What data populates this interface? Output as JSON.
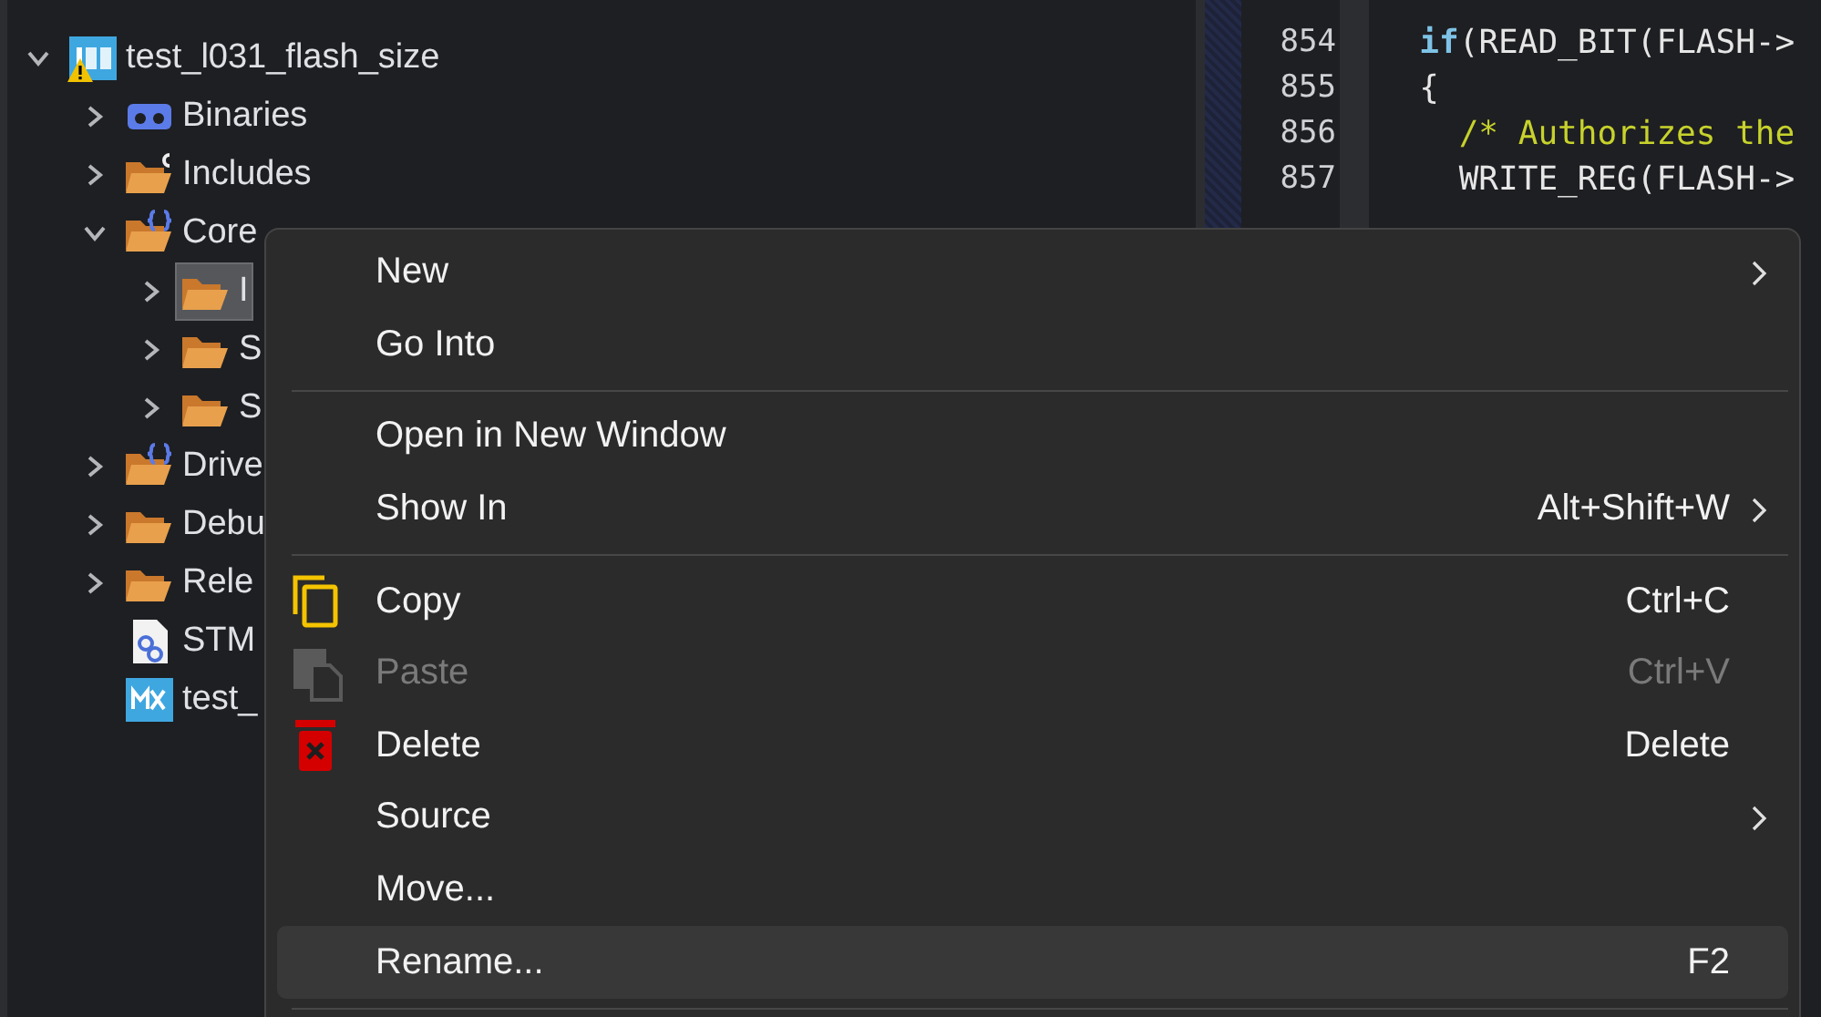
{
  "project_tree": [
    {
      "label": "test_l031_flash_size",
      "kind": "project",
      "expanded": true,
      "selected": false,
      "warning": true,
      "children": [
        {
          "label": "Binaries",
          "kind": "binaries",
          "expanded": false,
          "selected": false
        },
        {
          "label": "Includes",
          "kind": "includes",
          "expanded": false,
          "selected": false
        },
        {
          "label": "Core",
          "kind": "source-folder",
          "expanded": true,
          "selected": false,
          "children": [
            {
              "label": "I",
              "kind": "folder",
              "expanded": false,
              "selected": true
            },
            {
              "label": "S",
              "kind": "folder",
              "expanded": false,
              "selected": false
            },
            {
              "label": "S",
              "kind": "folder",
              "expanded": false,
              "selected": false
            }
          ]
        },
        {
          "label": "Drive",
          "kind": "source-folder",
          "expanded": false,
          "selected": false
        },
        {
          "label": "Debu",
          "kind": "folder",
          "expanded": false,
          "selected": false
        },
        {
          "label": "Rele",
          "kind": "folder",
          "expanded": false,
          "selected": false
        },
        {
          "label": "STM",
          "kind": "config-file",
          "selected": false
        },
        {
          "label": "test_",
          "kind": "mx-file",
          "selected": false
        }
      ]
    }
  ],
  "editor": {
    "lines": [
      {
        "number": "854",
        "segments": [
          {
            "kind": "keyword",
            "text": "  if"
          },
          {
            "kind": "plain",
            "text": "(READ_BIT(FLASH->"
          }
        ]
      },
      {
        "number": "855",
        "segments": [
          {
            "kind": "plain",
            "text": "  {"
          }
        ]
      },
      {
        "number": "856",
        "segments": [
          {
            "kind": "comment",
            "text": "    /* Authorizes the"
          }
        ]
      },
      {
        "number": "857",
        "segments": [
          {
            "kind": "plain",
            "text": "    WRITE_REG(FLASH->"
          }
        ]
      }
    ]
  },
  "context_menu": {
    "items": [
      {
        "kind": "plain",
        "label": "New",
        "submenu": true,
        "disabled": false,
        "highlighted": false
      },
      {
        "kind": "plain",
        "label": "Go Into",
        "submenu": false,
        "disabled": false,
        "highlighted": false
      },
      {
        "kind": "separator"
      },
      {
        "kind": "plain",
        "label": "Open in New Window",
        "submenu": false,
        "disabled": false,
        "highlighted": false
      },
      {
        "kind": "plain",
        "label": "Show In",
        "shortcut": "Alt+Shift+W",
        "submenu": true,
        "disabled": false,
        "highlighted": false
      },
      {
        "kind": "separator"
      },
      {
        "kind": "copy",
        "label": "Copy",
        "shortcut": "Ctrl+C",
        "submenu": false,
        "disabled": false,
        "highlighted": false
      },
      {
        "kind": "paste",
        "label": "Paste",
        "shortcut": "Ctrl+V",
        "submenu": false,
        "disabled": true,
        "highlighted": false
      },
      {
        "kind": "delete",
        "label": "Delete",
        "shortcut": "Delete",
        "submenu": false,
        "disabled": false,
        "highlighted": false
      },
      {
        "kind": "plain",
        "label": "Source",
        "submenu": true,
        "disabled": false,
        "highlighted": false
      },
      {
        "kind": "plain",
        "label": "Move...",
        "submenu": false,
        "disabled": false,
        "highlighted": false
      },
      {
        "kind": "plain",
        "label": "Rename...",
        "shortcut": "F2",
        "submenu": false,
        "disabled": false,
        "highlighted": true
      },
      {
        "kind": "separator"
      }
    ]
  }
}
